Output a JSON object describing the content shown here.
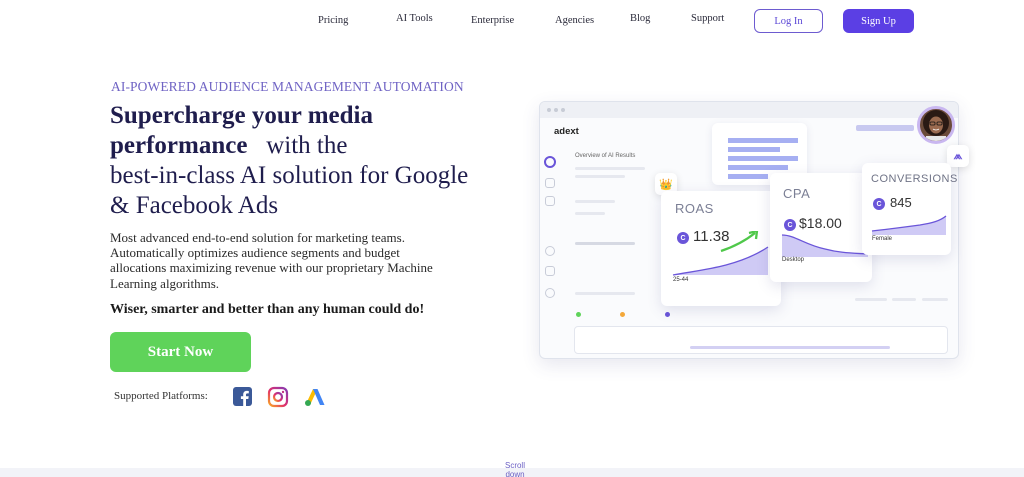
{
  "nav": {
    "items": [
      "Pricing",
      "AI Tools",
      "Enterprise",
      "Agencies",
      "Blog",
      "Support"
    ],
    "login": "Log In",
    "signup": "Sign Up"
  },
  "hero": {
    "eyebrow": "AI-POWERED AUDIENCE MANAGEMENT AUTOMATION",
    "headline_bold_1": "Supercharge your media",
    "headline_bold_2": "performance",
    "headline_rest_1": "with the",
    "headline_rest_2": "best-in-class AI solution for Google",
    "headline_rest_3": "& Facebook Ads",
    "description": "Most advanced end-to-end solution for marketing teams. Automatically optimizes audience segments and budget allocations maximizing revenue with our proprietary Machine Learning algorithms.",
    "tagline": "Wiser, smarter and better than any human could do!",
    "cta": "Start Now",
    "platforms_label": "Supported Platforms:",
    "platforms": [
      "facebook-icon",
      "instagram-icon",
      "google-ads-icon"
    ]
  },
  "mockup": {
    "logo": "adext",
    "section_title": "Overview of AI Results",
    "roas": {
      "title": "ROAS",
      "value": "11.38",
      "segment": "25-44"
    },
    "cpa": {
      "title": "CPA",
      "value": "$18.00",
      "segment": "Desktop"
    },
    "conversions": {
      "title": "CONVERSIONS",
      "value": "845",
      "segment": "Female"
    },
    "badge_letter": "C"
  },
  "footer": {
    "scroll_hint": "Scroll down"
  },
  "colors": {
    "brand_purple": "#5b3fe4",
    "cta_green": "#5fd35a",
    "eyebrow": "#6f63c4"
  }
}
